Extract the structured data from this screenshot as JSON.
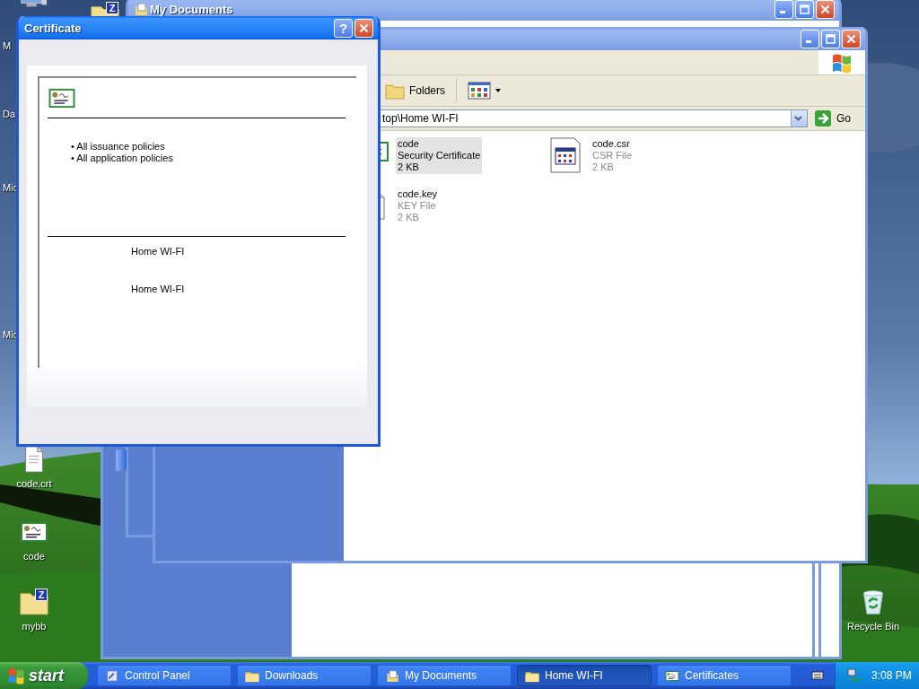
{
  "desktop_icons": [
    {
      "kind": "computer"
    },
    {
      "label": "M",
      "kind": "hidden"
    },
    {
      "kind": "zip-folder",
      "badge": "Z"
    },
    {
      "label": "Da",
      "kind": "hidden"
    },
    {
      "label": "Mic",
      "kind": "hidden"
    },
    {
      "label": "Mic",
      "kind": "hidden"
    },
    {
      "label": "code.crt",
      "kind": "document"
    },
    {
      "label": "code",
      "kind": "certificate"
    },
    {
      "label": "mybb",
      "kind": "zip-folder",
      "badge": "Z"
    },
    {
      "label": "Recycle Bin",
      "kind": "recycle"
    }
  ],
  "back_window": {
    "title": "My Documents"
  },
  "explorer": {
    "toolbar": [
      {
        "label": "Folders",
        "kind": "folders"
      },
      {
        "kind": "views"
      }
    ],
    "address": "top\\Home WI-FI",
    "go": "Go",
    "files": [
      {
        "name": "code",
        "type": "Security Certificate",
        "size": "2 KB",
        "kind": "certificate",
        "selected": true
      },
      {
        "name": "code.csr",
        "type": "CSR File",
        "size": "2 KB",
        "kind": "registry",
        "selected": false
      },
      {
        "name": "code.key",
        "type": "KEY File",
        "size": "2 KB",
        "kind": "document",
        "selected": false
      }
    ]
  },
  "certificate_dialog": {
    "title": "Certificate",
    "help": "?",
    "policies": [
      "• All issuance policies",
      "• All application policies"
    ],
    "issued_to": "Home WI-FI",
    "issued_by": "Home WI-FI"
  },
  "taskbar": {
    "start": "start",
    "items": [
      {
        "label": "Control Panel",
        "kind": "control-panel",
        "selected": false
      },
      {
        "label": "Downloads",
        "kind": "folder",
        "selected": false
      },
      {
        "label": "My Documents",
        "kind": "documents",
        "selected": false
      },
      {
        "label": "Home WI-FI",
        "kind": "folder",
        "selected": true
      },
      {
        "label": "Certificates",
        "kind": "certificate",
        "selected": false
      }
    ],
    "clock": "3:08 PM"
  }
}
